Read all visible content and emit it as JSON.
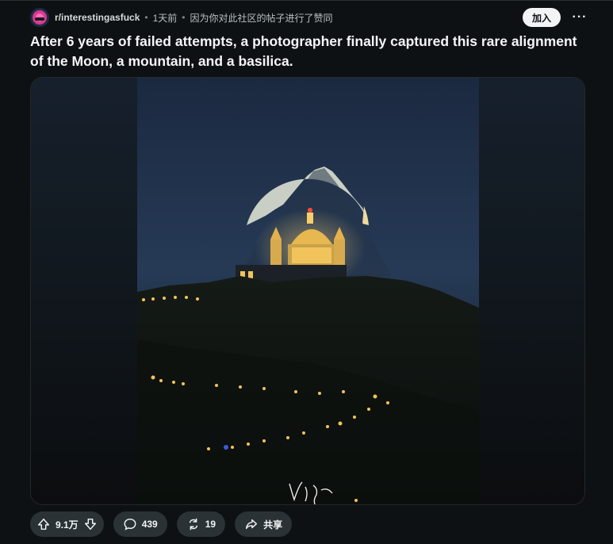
{
  "post": {
    "subreddit": "r/interestingasfuck",
    "time": "1天前",
    "reason": "因为你对此社区的帖子进行了赞同",
    "join_label": "加入",
    "more_label": "···",
    "title": "After 6 years of failed attempts, a photographer finally captured this rare alignment of the Moon, a mountain, and a basilica."
  },
  "actions": {
    "votes": "9.1万",
    "comments": "439",
    "shares_count": "19",
    "share_label": "共享"
  },
  "icons": {
    "upvote": "upvote-arrow-icon",
    "downvote": "downvote-arrow-icon",
    "comment": "comment-bubble-icon",
    "crosspost": "crosspost-icon",
    "share": "share-arrow-icon"
  },
  "colors": {
    "background": "#0e1113",
    "pill": "#2a3236",
    "join_button": "#f2f4f5"
  }
}
